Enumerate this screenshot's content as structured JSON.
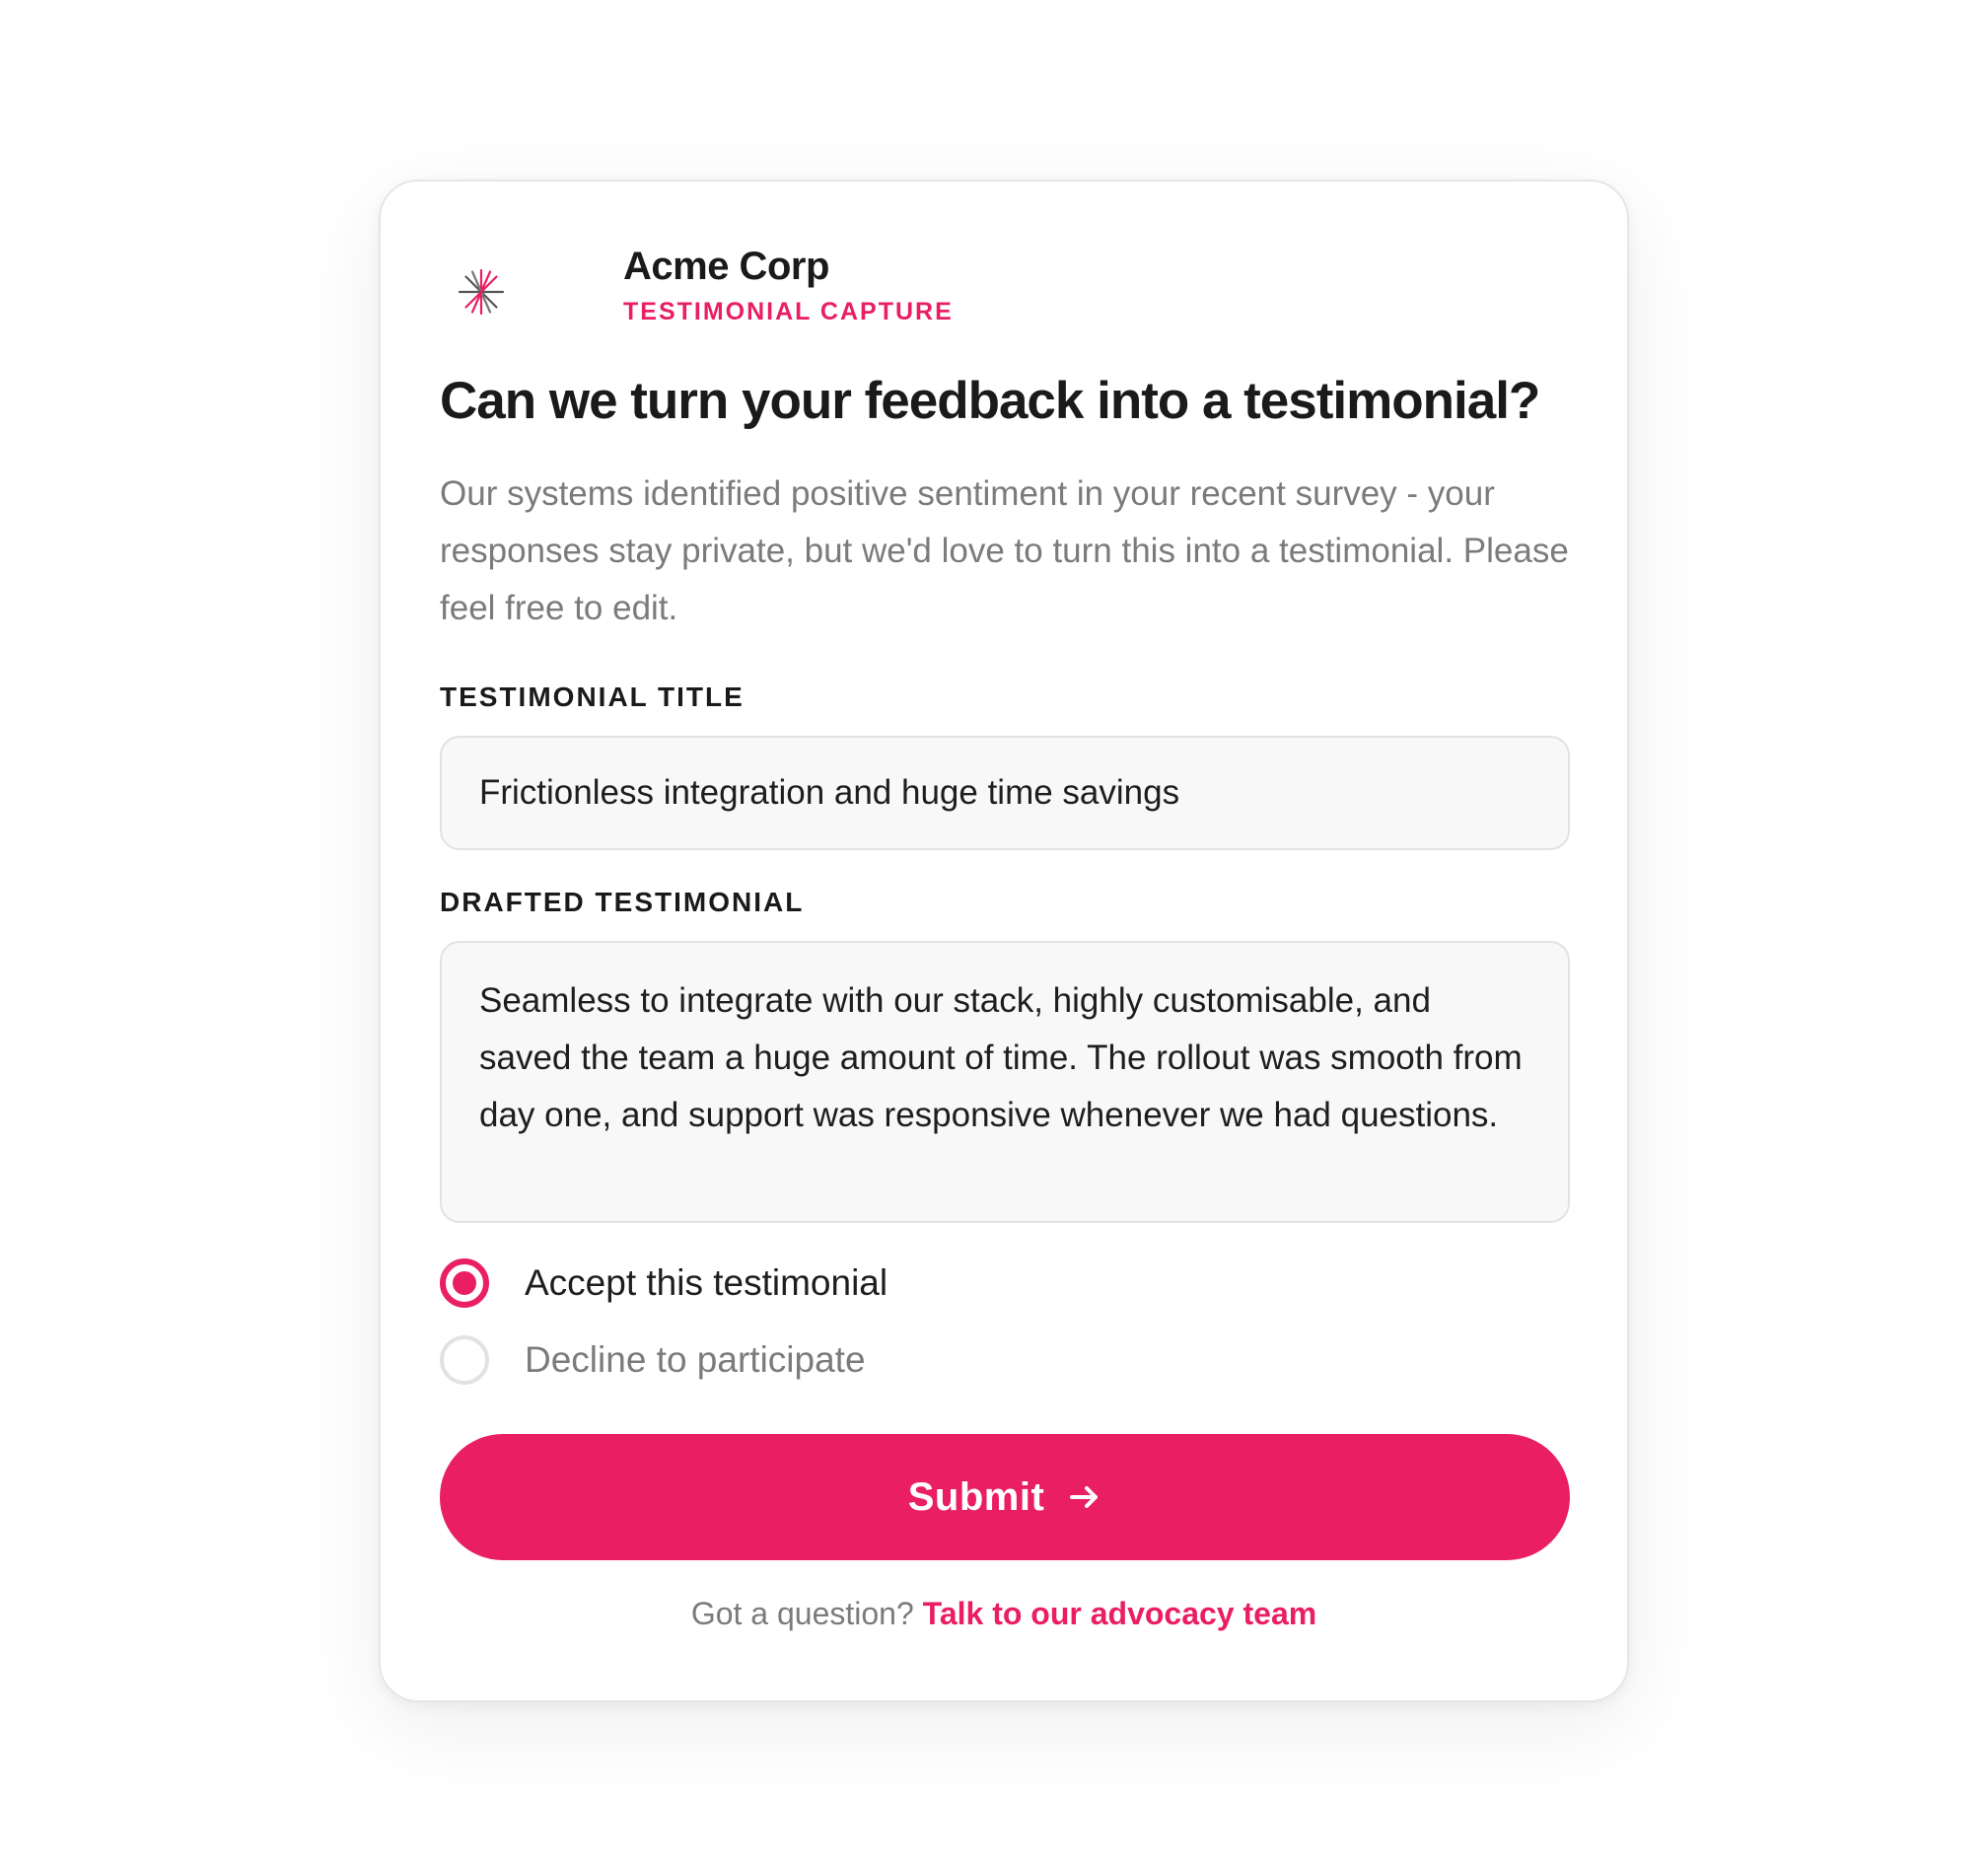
{
  "brand": {
    "name": "Acme Corp",
    "tagline": "TESTIMONIAL CAPTURE",
    "logo_icon": "sparkle-icon"
  },
  "heading": "Can we turn your feedback into a testimonial?",
  "intro": "Our systems identified positive sentiment in your recent survey - your responses stay private, but we'd love to turn this into a testimonial. Please feel free to edit.",
  "form": {
    "title_label": "TESTIMONIAL TITLE",
    "title_value": "Frictionless integration and huge time savings",
    "body_label": "DRAFTED TESTIMONIAL",
    "body_value": "Seamless to integrate with our stack, highly customisable, and saved the team a huge amount of time. The rollout was smooth from day one, and support was responsive whenever we had questions.",
    "options": [
      {
        "label": "Accept this testimonial",
        "selected": true
      },
      {
        "label": "Decline to participate",
        "selected": false
      }
    ],
    "submit_label": "Submit",
    "submit_icon": "arrow-right-icon"
  },
  "footer": {
    "prompt": "Got a question?",
    "link_label": "Talk to our advocacy team"
  },
  "colors": {
    "accent": "#e91e63",
    "text": "#1a1a1a",
    "muted": "#7b7b7b",
    "field_bg": "#f8f8f8",
    "border": "#e2e2e2"
  }
}
